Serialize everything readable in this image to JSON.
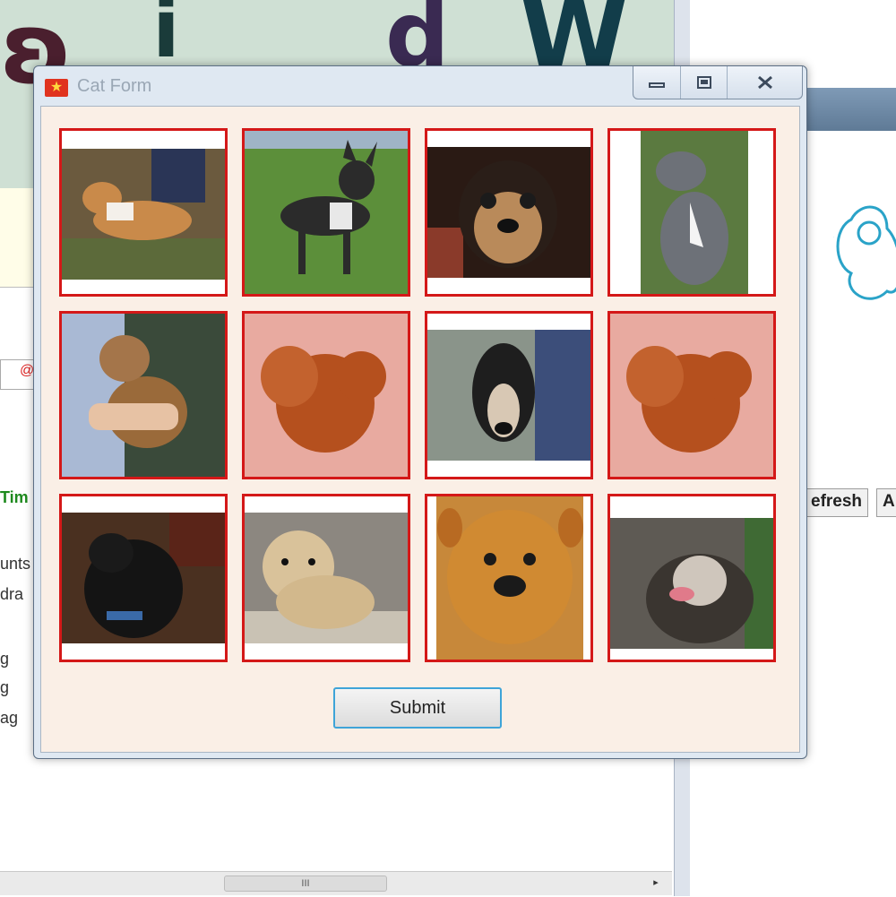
{
  "window": {
    "title": "Cat Form",
    "icon": "flag-icon",
    "submit_label": "Submit"
  },
  "background": {
    "left_fragments": [
      "Tim",
      "unts",
      "dra",
      "g",
      "g",
      "ag"
    ],
    "right_buttons": [
      "efresh",
      "A"
    ],
    "scroll_thumb": "III",
    "scroll_right_arrow": "▸"
  },
  "tiles": [
    {
      "name": "dog-photo-1",
      "desc_icon": "dog-image"
    },
    {
      "name": "dog-photo-2",
      "desc_icon": "dog-image"
    },
    {
      "name": "dog-photo-3",
      "desc_icon": "dog-image"
    },
    {
      "name": "dog-photo-4",
      "desc_icon": "dog-image"
    },
    {
      "name": "dog-photo-5",
      "desc_icon": "dog-image"
    },
    {
      "name": "dog-photo-6",
      "desc_icon": "dog-image"
    },
    {
      "name": "dog-photo-7",
      "desc_icon": "dog-image"
    },
    {
      "name": "dog-photo-8",
      "desc_icon": "dog-image"
    },
    {
      "name": "dog-photo-9",
      "desc_icon": "dog-image"
    },
    {
      "name": "dog-photo-10",
      "desc_icon": "dog-image"
    },
    {
      "name": "dog-photo-11",
      "desc_icon": "dog-image"
    },
    {
      "name": "dog-photo-12",
      "desc_icon": "dog-image"
    }
  ],
  "colors": {
    "tile_border": "#d41818",
    "form_background": "#faefe6",
    "submit_focus_border": "#3ea4d8"
  }
}
